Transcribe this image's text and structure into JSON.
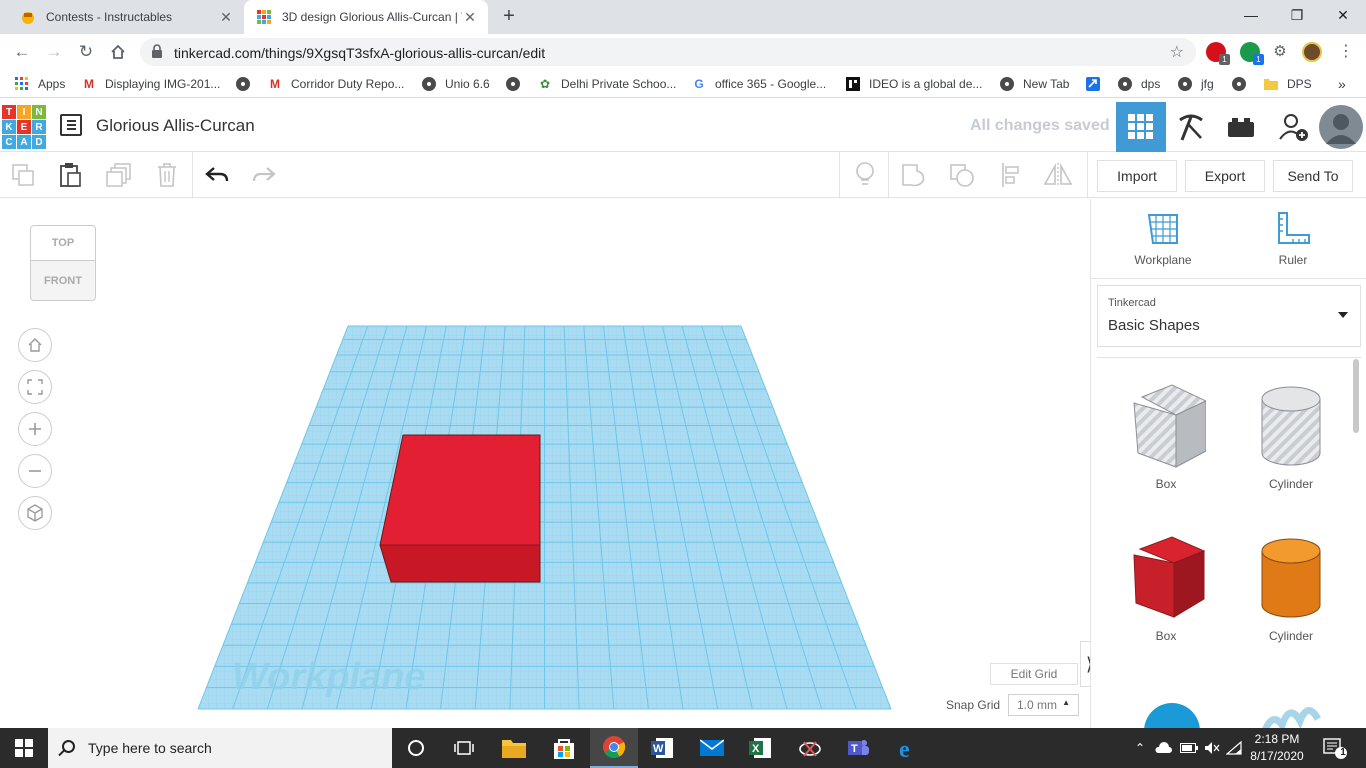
{
  "browser": {
    "tabs": [
      {
        "title": "Contests - Instructables",
        "active": false
      },
      {
        "title": "3D design Glorious Allis-Curcan | T",
        "active": true
      }
    ],
    "url": "tinkercad.com/things/9XgsqT3sfxA-glorious-allis-curcan/edit",
    "ext_badges": [
      "1",
      "1"
    ],
    "bookmarks": [
      {
        "label": "Apps",
        "icon": "apps-grid-icon"
      },
      {
        "label": "Displaying IMG-201...",
        "icon": "gmail-icon"
      },
      {
        "label": "",
        "icon": "globe-icon"
      },
      {
        "label": "Corridor Duty Repo...",
        "icon": "gmail-icon"
      },
      {
        "label": "Unio 6.6",
        "icon": "globe-icon"
      },
      {
        "label": "",
        "icon": "globe-icon"
      },
      {
        "label": "Delhi Private Schoo...",
        "icon": "school-icon"
      },
      {
        "label": "office 365 - Google...",
        "icon": "google-icon"
      },
      {
        "label": "IDEO is a global de...",
        "icon": "ideo-icon"
      },
      {
        "label": "New Tab",
        "icon": "globe-icon"
      },
      {
        "label": "",
        "icon": "blue-arrow-icon"
      },
      {
        "label": "dps",
        "icon": "globe-icon"
      },
      {
        "label": "jfg",
        "icon": "globe-icon"
      },
      {
        "label": "",
        "icon": "globe-icon"
      },
      {
        "label": "DPS",
        "icon": "folder-icon"
      }
    ],
    "more": "»"
  },
  "tinkercad": {
    "logo_letters": [
      "T",
      "I",
      "N",
      "K",
      "E",
      "R",
      "C",
      "A",
      "D"
    ],
    "design_title": "Glorious Allis-Curcan",
    "save_status": "All changes saved",
    "toolbar": {
      "import": "Import",
      "export": "Export",
      "send_to": "Send To"
    },
    "viewcube": {
      "top": "TOP",
      "front": "FRONT"
    },
    "workplane_label": "Workplane",
    "edit_grid": "Edit Grid",
    "snap_grid_label": "Snap Grid",
    "snap_grid_value": "1.0 mm",
    "panel": {
      "tools": [
        {
          "label": "Workplane",
          "icon": "workplane-icon"
        },
        {
          "label": "Ruler",
          "icon": "ruler-icon"
        }
      ],
      "library_source": "Tinkercad",
      "library_name": "Basic Shapes",
      "shapes": [
        {
          "label": "Box",
          "kind": "hole-box"
        },
        {
          "label": "Cylinder",
          "kind": "hole-cylinder"
        },
        {
          "label": "Box",
          "kind": "box",
          "color": "#c8202b"
        },
        {
          "label": "Cylinder",
          "kind": "cylinder",
          "color": "#e07a16"
        }
      ]
    },
    "scene": {
      "workplane_color": "#a9dcf2",
      "grid_color": "#6ec6e9",
      "box_color": "#e21f33"
    }
  },
  "taskbar": {
    "search_placeholder": "Type here to search",
    "time": "2:18 PM",
    "date": "8/17/2020",
    "notification_count": "1"
  }
}
